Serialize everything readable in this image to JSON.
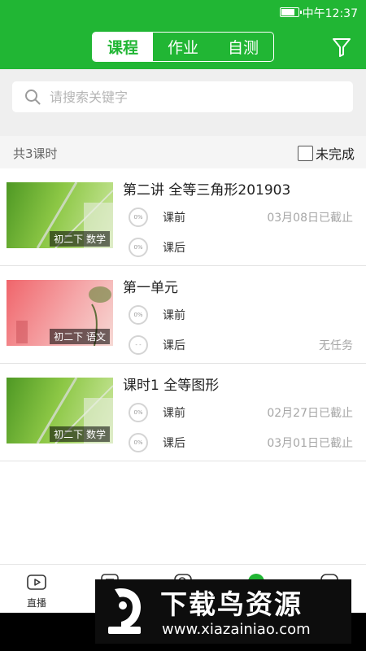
{
  "status_bar": {
    "time": "中午12:37"
  },
  "header": {
    "tabs": [
      {
        "label": "课程",
        "active": true
      },
      {
        "label": "作业",
        "active": false
      },
      {
        "label": "自测",
        "active": false
      }
    ]
  },
  "search": {
    "placeholder": "请搜索关键字"
  },
  "summary": {
    "count_text": "共3课时",
    "filter_label": "未完成",
    "filter_checked": false
  },
  "lessons": [
    {
      "title": "第二讲  全等三角形201903",
      "tag": "初二下 数学",
      "thumb": "green",
      "tasks": [
        {
          "ring": "0%",
          "label": "课前",
          "status": "03月08日已截止"
        },
        {
          "ring": "0%",
          "label": "课后",
          "status": ""
        }
      ]
    },
    {
      "title": "第一单元",
      "tag": "初二下 语文",
      "thumb": "red",
      "tasks": [
        {
          "ring": "0%",
          "label": "课前",
          "status": ""
        },
        {
          "ring": "- -",
          "label": "课后",
          "status": "无任务"
        }
      ]
    },
    {
      "title": "课时1 全等图形",
      "tag": "初二下 数学",
      "thumb": "green",
      "tasks": [
        {
          "ring": "0%",
          "label": "课前",
          "status": "02月27日已截止"
        },
        {
          "ring": "0%",
          "label": "课后",
          "status": "03月01日已截止"
        }
      ]
    }
  ],
  "tabbar": {
    "items": [
      {
        "label": "直播",
        "icon": "video-icon"
      },
      {
        "label": "",
        "icon": "list-icon"
      },
      {
        "label": "",
        "icon": "search-icon"
      },
      {
        "label": "",
        "icon": "active-tab-icon"
      },
      {
        "label": "",
        "icon": "profile-icon"
      }
    ]
  },
  "watermark": {
    "title": "下载鸟资源",
    "url": "www.xiazainiao.com"
  },
  "colors": {
    "brand_green": "#21b634",
    "muted_gray": "#a6a6a6"
  }
}
